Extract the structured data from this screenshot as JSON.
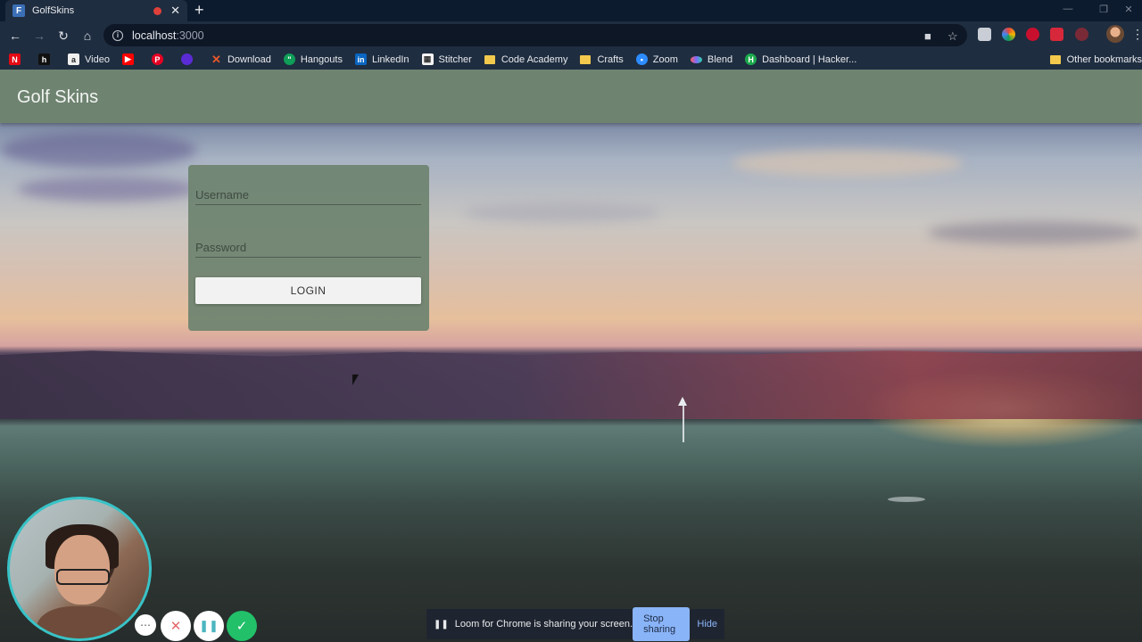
{
  "browser": {
    "tab": {
      "title": "GolfSkins",
      "favicon": "golf-skins-favicon"
    },
    "address": {
      "host": "localhost",
      "port": ":3000"
    },
    "bookmarks": [
      {
        "label": "",
        "icon": "netflix-icon",
        "color": "#e50914"
      },
      {
        "label": "",
        "icon": "hackerrank-icon",
        "color": "#111111"
      },
      {
        "label": "Video",
        "icon": "amazon-icon",
        "color": "#f0f0f0"
      },
      {
        "label": "",
        "icon": "youtube-icon",
        "color": "#ff0000"
      },
      {
        "label": "",
        "icon": "pinterest-icon",
        "color": "#e60023"
      },
      {
        "label": "",
        "icon": "purple-circle-icon",
        "color": "#5b2bd6"
      },
      {
        "label": "Download",
        "icon": "x-icon",
        "color": "#e8582a"
      },
      {
        "label": "Hangouts",
        "icon": "hangouts-icon",
        "color": "#0f9d58"
      },
      {
        "label": "LinkedIn",
        "icon": "linkedin-icon",
        "color": "#0a66c2"
      },
      {
        "label": "Stitcher",
        "icon": "stitcher-icon",
        "color": "#f4f4f4"
      },
      {
        "label": "Code Academy",
        "icon": "folder-icon",
        "color": "#f2c94c"
      },
      {
        "label": "Crafts",
        "icon": "folder-icon",
        "color": "#f2c94c"
      },
      {
        "label": "Zoom",
        "icon": "zoom-icon",
        "color": "#2d8cff"
      },
      {
        "label": "Blend",
        "icon": "blend-icon",
        "color": "#7a6cff"
      },
      {
        "label": "Dashboard | Hacker...",
        "icon": "hackerrank-icon",
        "color": "#1ba94c"
      }
    ],
    "other_bookmarks": "Other bookmarks"
  },
  "app": {
    "title": "Golf Skins",
    "login": {
      "username_placeholder": "Username",
      "password_placeholder": "Password",
      "button_label": "LOGIN"
    }
  },
  "loom": {
    "share_message": "Loom for Chrome is sharing your screen.",
    "stop_label": "Stop sharing",
    "hide_label": "Hide"
  },
  "colors": {
    "appbar": "#6e8370",
    "accent_loom": "#38c3c7",
    "done_green": "#22c069"
  }
}
